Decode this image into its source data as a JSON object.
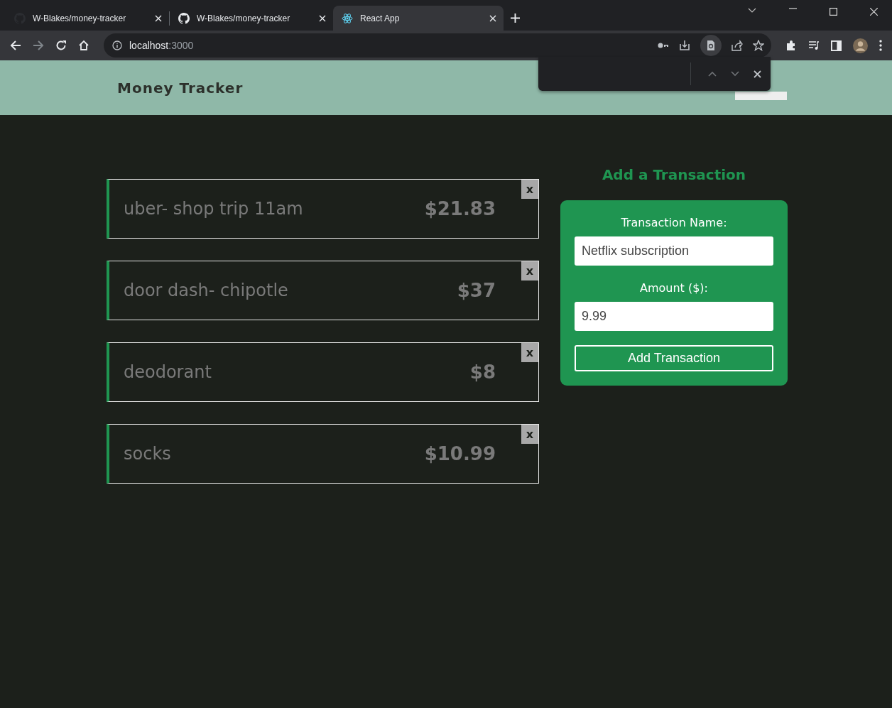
{
  "browser": {
    "tabs": [
      {
        "title": "W-Blakes/money-tracker",
        "selected": false
      },
      {
        "title": "W-Blakes/money-tracker",
        "selected": false
      },
      {
        "title": "React App",
        "selected": true
      }
    ],
    "url_host": "localhost",
    "url_port": ":3000"
  },
  "header": {
    "title": "Money Tracker"
  },
  "transactions": [
    {
      "name": "uber- shop trip 11am",
      "amount": "$21.83",
      "delete": "x"
    },
    {
      "name": "door dash- chipotle",
      "amount": "$37",
      "delete": "x"
    },
    {
      "name": "deodorant",
      "amount": "$8",
      "delete": "x"
    },
    {
      "name": "socks",
      "amount": "$10.99",
      "delete": "x"
    }
  ],
  "form": {
    "heading": "Add a Transaction",
    "name_label": "Transaction Name:",
    "name_value": "Netflix subscription",
    "amount_label": "Amount ($):",
    "amount_value": "9.99",
    "submit": "Add Transaction"
  }
}
